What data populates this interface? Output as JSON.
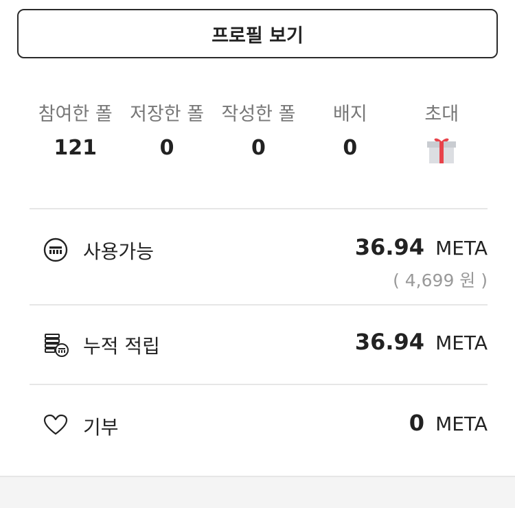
{
  "profile_button": {
    "label": "프로필 보기"
  },
  "stats": [
    {
      "label": "참여한 폴",
      "value": "121"
    },
    {
      "label": "저장한 폴",
      "value": "0"
    },
    {
      "label": "작성한 폴",
      "value": "0"
    },
    {
      "label": "배지",
      "value": "0"
    },
    {
      "label": "초대",
      "icon": "gift-icon"
    }
  ],
  "wallet": {
    "available": {
      "icon": "meta-coin-icon",
      "label": "사용가능",
      "amount": "36.94",
      "unit": "META",
      "krw": "( 4,699 원 )"
    },
    "accumulated": {
      "icon": "coin-stack-icon",
      "label": "누적 적립",
      "amount": "36.94",
      "unit": "META"
    },
    "donation": {
      "icon": "heart-icon",
      "label": "기부",
      "amount": "0",
      "unit": "META"
    }
  },
  "colors": {
    "gift_ribbon": "#e8434b",
    "gift_box": "#d9dbdf",
    "divider": "#e6e6e6"
  }
}
